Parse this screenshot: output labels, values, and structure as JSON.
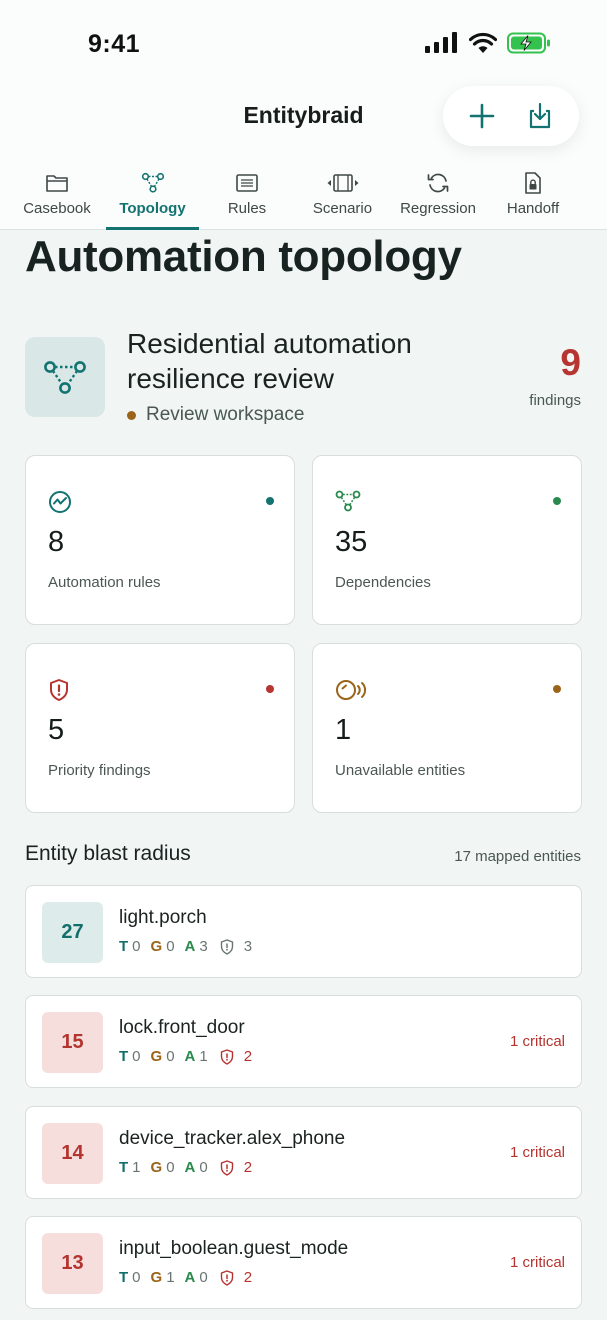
{
  "status_bar": {
    "time": "9:41"
  },
  "header": {
    "title": "Entitybraid",
    "add_icon": "plus-icon",
    "import_icon": "download-icon"
  },
  "tabs": [
    {
      "label": "Casebook",
      "icon": "folder-icon",
      "active": false
    },
    {
      "label": "Topology",
      "icon": "topology-icon",
      "active": true
    },
    {
      "label": "Rules",
      "icon": "list-icon",
      "active": false
    },
    {
      "label": "Scenario",
      "icon": "film-icon",
      "active": false
    },
    {
      "label": "Regression",
      "icon": "refresh-icon",
      "active": false
    },
    {
      "label": "Handoff",
      "icon": "lock-document-icon",
      "active": false
    }
  ],
  "page": {
    "title": "Automation topology"
  },
  "workspace": {
    "title": "Residential automation resilience review",
    "subtitle": "Review workspace",
    "findings_count": "9",
    "findings_label": "findings"
  },
  "stats": [
    {
      "value": "8",
      "label": "Automation rules",
      "icon": "activity-icon",
      "dot_color": "#127370"
    },
    {
      "value": "35",
      "label": "Dependencies",
      "icon": "topology-icon",
      "dot_color": "#2a8a4e"
    },
    {
      "value": "5",
      "label": "Priority findings",
      "icon": "shield-alert-icon",
      "dot_color": "#b73531"
    },
    {
      "value": "1",
      "label": "Unavailable entities",
      "icon": "signal-off-icon",
      "dot_color": "#9b6418"
    }
  ],
  "blast_radius": {
    "title": "Entity blast radius",
    "meta": "17 mapped entities",
    "rows": [
      {
        "score": "27",
        "entity": "light.porch",
        "t": "0",
        "g": "0",
        "a": "3",
        "f": "3",
        "badge": "",
        "severity": "normal"
      },
      {
        "score": "15",
        "entity": "lock.front_door",
        "t": "0",
        "g": "0",
        "a": "1",
        "f": "2",
        "badge": "1 critical",
        "severity": "critical"
      },
      {
        "score": "14",
        "entity": "device_tracker.alex_phone",
        "t": "1",
        "g": "0",
        "a": "0",
        "f": "2",
        "badge": "1 critical",
        "severity": "critical"
      },
      {
        "score": "13",
        "entity": "input_boolean.guest_mode",
        "t": "0",
        "g": "1",
        "a": "0",
        "f": "2",
        "badge": "1 critical",
        "severity": "critical"
      }
    ],
    "metric_letters": {
      "t": "T",
      "g": "G",
      "a": "A"
    }
  }
}
